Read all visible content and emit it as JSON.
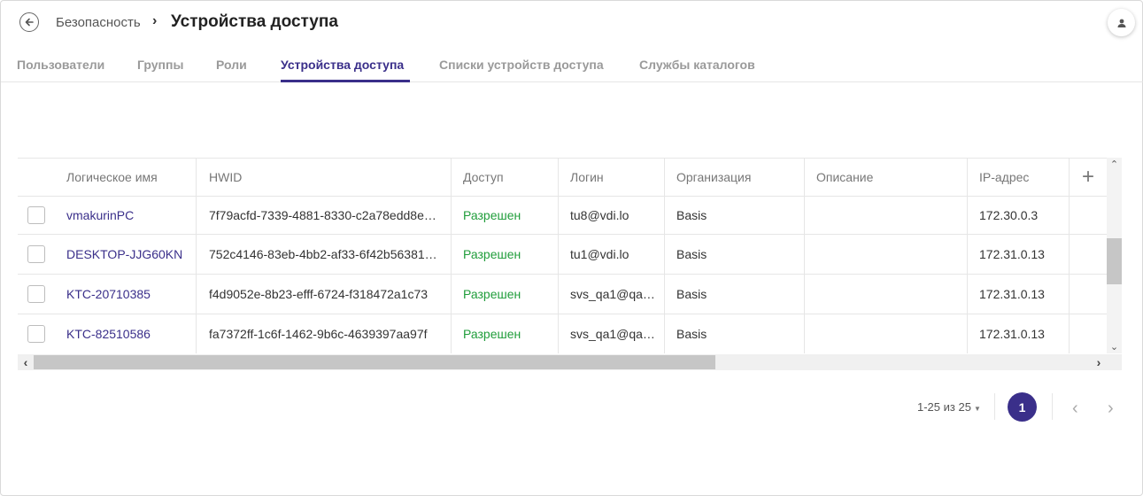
{
  "header": {
    "breadcrumb_parent": "Безопасность",
    "breadcrumb_sep": "›",
    "title": "Устройства доступа"
  },
  "tabs": [
    {
      "label": "Пользователи"
    },
    {
      "label": "Группы"
    },
    {
      "label": "Роли"
    },
    {
      "label": "Устройства доступа",
      "active": true
    },
    {
      "label": "Списки устройств доступа"
    },
    {
      "label": "Службы каталогов"
    }
  ],
  "table": {
    "columns": [
      "Логическое имя",
      "HWID",
      "Доступ",
      "Логин",
      "Организация",
      "Описание",
      "IP-адрес"
    ],
    "add_column_label": "+",
    "rows": [
      {
        "name": "vmakurinPC",
        "hwid": "7f79acfd-7339-4881-8330-c2a78edd8e…",
        "access": "Разрешен",
        "login": "tu8@vdi.lo",
        "org": "Basis",
        "desc": "",
        "ip": "172.30.0.3"
      },
      {
        "name": "DESKTOP-JJG60KN",
        "hwid": "752c4146-83eb-4bb2-af33-6f42b56381…",
        "access": "Разрешен",
        "login": "tu1@vdi.lo",
        "org": "Basis",
        "desc": "",
        "ip": "172.31.0.13"
      },
      {
        "name": "KTC-20710385",
        "hwid": "f4d9052e-8b23-efff-6724-f318472a1c73",
        "access": "Разрешен",
        "login": "svs_qa1@qa…",
        "org": "Basis",
        "desc": "",
        "ip": "172.31.0.13"
      },
      {
        "name": "KTC-82510586",
        "hwid": "fa7372ff-1c6f-1462-9b6c-4639397aa97f",
        "access": "Разрешен",
        "login": "svs_qa1@qa…",
        "org": "Basis",
        "desc": "",
        "ip": "172.31.0.13"
      }
    ]
  },
  "pagination": {
    "range": "1-25 из 25",
    "current_page": "1",
    "prev": "‹",
    "next": "›"
  },
  "colors": {
    "accent": "#3a2f8a",
    "allowed": "#1f9d3a"
  },
  "icons": {
    "back": "back-arrow-icon",
    "avatar": "user-icon",
    "scroll_up": "chevron-up-icon",
    "scroll_down": "chevron-down-icon",
    "scroll_left": "chevron-left-icon",
    "scroll_right": "chevron-right-icon"
  }
}
